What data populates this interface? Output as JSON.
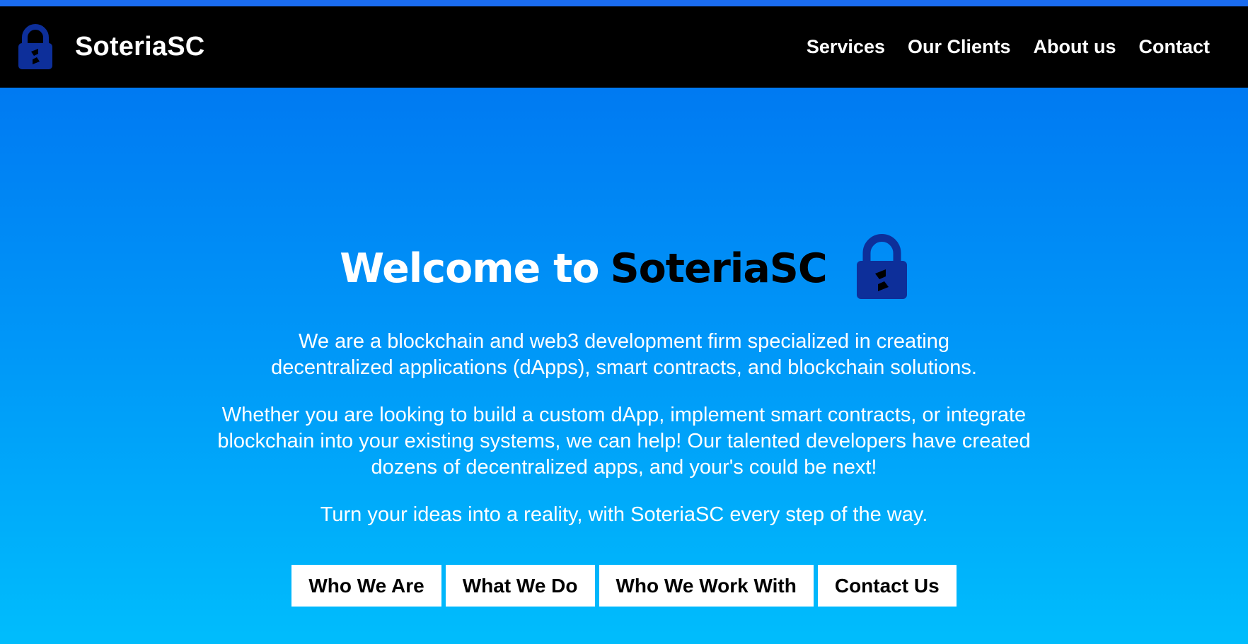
{
  "brand": {
    "name": "SoteriaSC",
    "logo_icon": "padlock-icon",
    "lock_color": "#0d2f9a"
  },
  "nav": {
    "links": [
      "Services",
      "Our Clients",
      "About us",
      "Contact"
    ]
  },
  "hero": {
    "title_prefix": "Welcome to",
    "title_brand": "SoteriaSC",
    "lock_icon": "padlock-icon",
    "paragraphs": [
      "We are a blockchain and web3 development firm specialized in creating decentralized applications (dApps), smart contracts, and blockchain solutions.",
      "Whether you are looking to build a custom dApp, implement smart contracts, or integrate blockchain into your existing systems, we can help! Our talented developers have created dozens of decentralized apps, and your's could be next!",
      "Turn your ideas into a reality, with SoteriaSC every step of the way."
    ],
    "buttons": [
      "Who We Are",
      "What We Do",
      "Who We Work With",
      "Contact Us"
    ]
  },
  "colors": {
    "accent": "#1a6cf0",
    "gradient_top": "#0070f0",
    "gradient_bottom": "#00bdfc",
    "navbar": "#000000"
  }
}
